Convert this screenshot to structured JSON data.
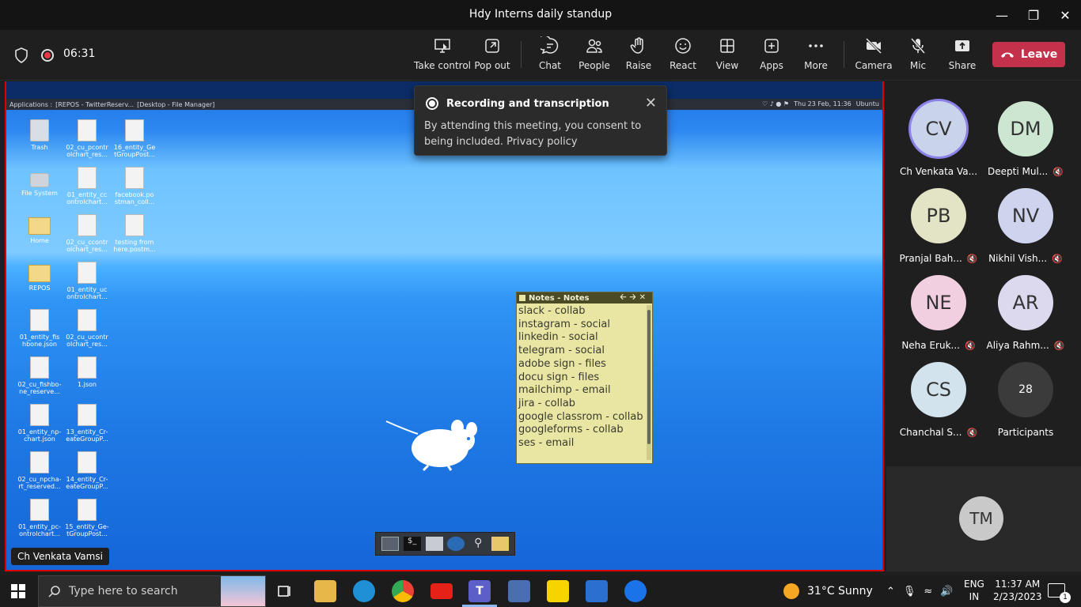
{
  "window": {
    "title": "Hdy Interns daily standup"
  },
  "toolbar": {
    "timer": "06:31",
    "buttons": [
      {
        "label": "Take control",
        "icon": "take-control-icon"
      },
      {
        "label": "Pop out",
        "icon": "pop-out-icon"
      },
      {
        "label": "Chat",
        "icon": "chat-icon"
      },
      {
        "label": "People",
        "icon": "people-icon"
      },
      {
        "label": "Raise",
        "icon": "raise-hand-icon"
      },
      {
        "label": "React",
        "icon": "react-icon"
      },
      {
        "label": "View",
        "icon": "view-icon"
      },
      {
        "label": "Apps",
        "icon": "apps-icon"
      },
      {
        "label": "More",
        "icon": "more-icon"
      },
      {
        "label": "Camera",
        "icon": "camera-off-icon"
      },
      {
        "label": "Mic",
        "icon": "mic-off-icon"
      },
      {
        "label": "Share",
        "icon": "share-icon"
      }
    ],
    "leave_label": "Leave",
    "leave_color": "#c4314b"
  },
  "toast": {
    "title": "Recording and transcription",
    "body": "By attending this meeting, you consent to being included. Privacy policy"
  },
  "shared_screen": {
    "presenter_name": "Ch Venkata Vamsi",
    "panel": {
      "applications": "Applications :",
      "task1": "[REPOS - TwitterReserv...",
      "task2": "[Desktop - File Manager]",
      "datetime": "Thu 23 Feb, 11:36",
      "user": "Ubuntu"
    },
    "desktop_icons": [
      {
        "label": "Trash",
        "kind": "trash"
      },
      {
        "label": "02_cu_pcontr olchart_res...",
        "kind": "file"
      },
      {
        "label": "16_entity_Ge tGroupPost...",
        "kind": "file"
      },
      {
        "label": "File System",
        "kind": "fs"
      },
      {
        "label": "01_entity_cc ontrolchart...",
        "kind": "file"
      },
      {
        "label": "facebook.po stman_coll...",
        "kind": "file"
      },
      {
        "label": "Home",
        "kind": "folder"
      },
      {
        "label": "02_cu_ccontr olchart_res...",
        "kind": "file"
      },
      {
        "label": "testing from here.postm...",
        "kind": "file"
      },
      {
        "label": "REPOS",
        "kind": "folder"
      },
      {
        "label": "01_entity_uc ontrolchart...",
        "kind": "file"
      },
      {
        "label": "01_entity_fis hbone.json",
        "kind": "file"
      },
      {
        "label": "02_cu_ucontr olchart_res...",
        "kind": "file"
      },
      {
        "label": "02_cu_fishbo- ne_reserve...",
        "kind": "file"
      },
      {
        "label": "1.json",
        "kind": "file"
      },
      {
        "label": "01_entity_np- chart.json",
        "kind": "file"
      },
      {
        "label": "13_entity_Cr- eateGroupP...",
        "kind": "file"
      },
      {
        "label": "02_cu_npcha- rt_reserved...",
        "kind": "file"
      },
      {
        "label": "14_entity_Cr- eateGroupP...",
        "kind": "file"
      },
      {
        "label": "01_entity_pc- ontrolchart...",
        "kind": "file"
      },
      {
        "label": "15_entity_Ge- tGroupPost...",
        "kind": "file"
      }
    ],
    "notes": {
      "title": "Notes - Notes",
      "lines": [
        "slack - collab",
        "instagram - social",
        "linkedin - social",
        "telegram - social",
        "adobe sign - files",
        "docu sign - files",
        "mailchimp - email",
        "jira - collab",
        "google classrom - collab",
        "googleforms - collab",
        "ses - email"
      ]
    }
  },
  "participants": [
    {
      "initials": "CV",
      "name": "Ch Venkata Va...",
      "muted": false,
      "bg": "#c9d3ea",
      "speaking": true
    },
    {
      "initials": "DM",
      "name": "Deepti Mul...",
      "muted": true,
      "bg": "#cde6d2",
      "speaking": false
    },
    {
      "initials": "PB",
      "name": "Pranjal Bah...",
      "muted": true,
      "bg": "#e3e3c6",
      "speaking": false
    },
    {
      "initials": "NV",
      "name": "Nikhil Vish...",
      "muted": true,
      "bg": "#cfd4ee",
      "speaking": false
    },
    {
      "initials": "NE",
      "name": "Neha Eruk...",
      "muted": true,
      "bg": "#f2cfe0",
      "speaking": false
    },
    {
      "initials": "AR",
      "name": "Aliya Rahm...",
      "muted": true,
      "bg": "#dcd9ee",
      "speaking": false
    },
    {
      "initials": "CS",
      "name": "Chanchal S...",
      "muted": true,
      "bg": "#d3e3ee",
      "speaking": false
    },
    {
      "initials": "28",
      "name": "Participants",
      "muted": false,
      "bg": "#3b3b3b",
      "speaking": false
    }
  ],
  "self_tile": {
    "initials": "TM"
  },
  "taskbar": {
    "search_placeholder": "Type here to search",
    "weather": "31°C  Sunny",
    "lang_top": "ENG",
    "lang_bottom": "IN",
    "time": "11:37 AM",
    "date": "2/23/2023",
    "notification_count": "1"
  }
}
